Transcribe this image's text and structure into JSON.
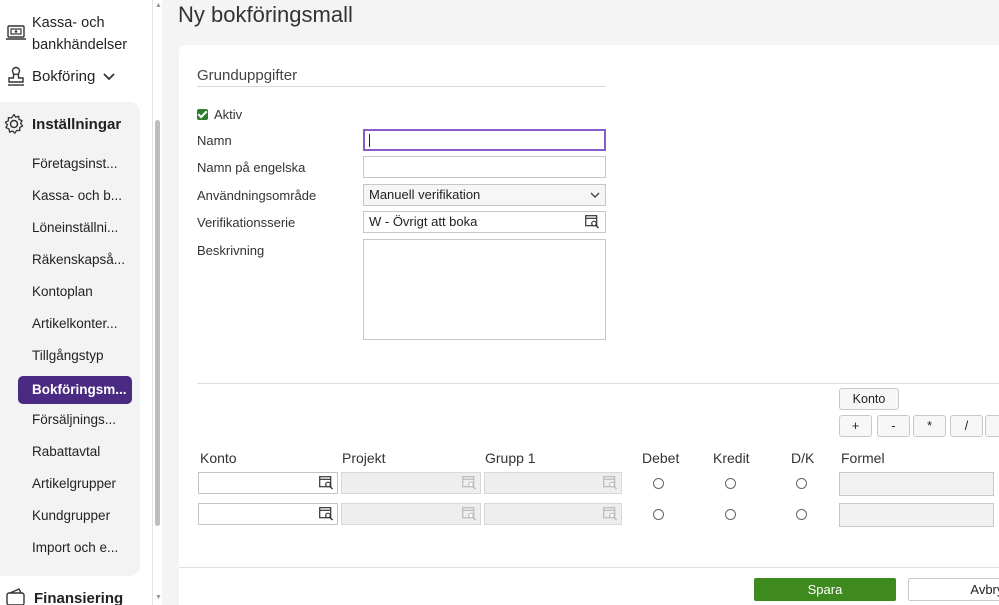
{
  "sidebar": {
    "kassa_label_line1": "Kassa- och",
    "kassa_label_line2": "bankhändelser",
    "bokforing_label": "Bokföring",
    "settings_label": "Inställningar",
    "sub_items": [
      "Företagsinst...",
      "Kassa- och b...",
      "Löneinställni...",
      "Räkenskapså...",
      "Kontoplan",
      "Artikelkonter...",
      "Tillgångstyp",
      "Bokföringsm...",
      "Försäljnings...",
      "Rabattavtal",
      "Artikelgrupper",
      "Kundgrupper",
      "Import och e..."
    ],
    "active_index": 7,
    "finansiering_label": "Finansiering"
  },
  "page": {
    "title": "Ny bokföringsmall"
  },
  "form": {
    "section_title": "Grunduppgifter",
    "aktiv_label": "Aktiv",
    "aktiv_checked": true,
    "namn_label": "Namn",
    "namn_value": "",
    "namn_engelska_label": "Namn på engelska",
    "namn_engelska_value": "",
    "anvandningsomrade_label": "Användningsområde",
    "anvandningsomrade_value": "Manuell verifikation",
    "verifikationsserie_label": "Verifikationsserie",
    "verifikationsserie_value": "W - Övrigt att boka",
    "beskrivning_label": "Beskrivning",
    "beskrivning_value": ""
  },
  "formula_buttons": {
    "konto": "Konto",
    "plus": "+",
    "minus": "-",
    "multiply": "*",
    "divide": "/"
  },
  "grid": {
    "headers": [
      "Konto",
      "Projekt",
      "Grupp 1",
      "Debet",
      "Kredit",
      "D/K",
      "Formel"
    ],
    "row_count": 2
  },
  "footer": {
    "save_label": "Spara",
    "cancel_label": "Avbryt"
  },
  "colors": {
    "active_nav": "#4a2a82",
    "save_button": "#3f8a1f",
    "focus_border": "#8a5cc9",
    "checkbox": "#2e7d32"
  }
}
